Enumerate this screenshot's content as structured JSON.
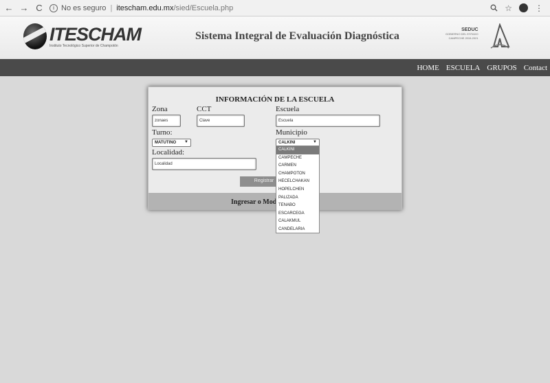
{
  "browser": {
    "back": "←",
    "forward": "→",
    "reload": "C",
    "info": "i",
    "security": "No es seguro",
    "separator": "|",
    "host": "itescham.edu.mx",
    "path": "/sied/Escuela.php",
    "zoom_icon": "search-icon",
    "star": "☆",
    "menu": "⋮"
  },
  "header": {
    "logo_text": "ITESCHAM",
    "logo_sub": "Instituto Tecnológico Superior de Champotón",
    "title": "Sistema Integral de Evaluación Diagnóstica",
    "seduc_name": "SEDUC",
    "seduc_line1": "GOBIERNO DEL ESTADO",
    "seduc_line2": "CAMPECHE 2015-2021"
  },
  "nav": {
    "items": [
      "HOME",
      "ESCUELA",
      "GRUPOS",
      "Contact"
    ]
  },
  "form": {
    "title": "INFORMACIÓN DE LA ESCUELA",
    "zona_label": "Zona",
    "zona_value": "zonaes",
    "cct_label": "CCT",
    "cct_value": "Clave",
    "escuela_label": "Escuela",
    "escuela_value": "Escuela",
    "turno_label": "Turno:",
    "turno_value": "MATUTINO",
    "municipio_label": "Municipio",
    "municipio_value": "CALKINI",
    "localidad_label": "Localidad:",
    "localidad_value": "Localidad",
    "register_label": "Registrar",
    "footer_label": "Ingresar o Modif"
  },
  "municipios": [
    "CALKINI",
    "CAMPECHE",
    "CARMEN",
    "CHAMPOTON",
    "HECELCHAKAN",
    "HOPELCHEN",
    "PALIZADA",
    "TENABO",
    "ESCARCEGA",
    "CALAKMUL",
    "CANDELARIA"
  ]
}
